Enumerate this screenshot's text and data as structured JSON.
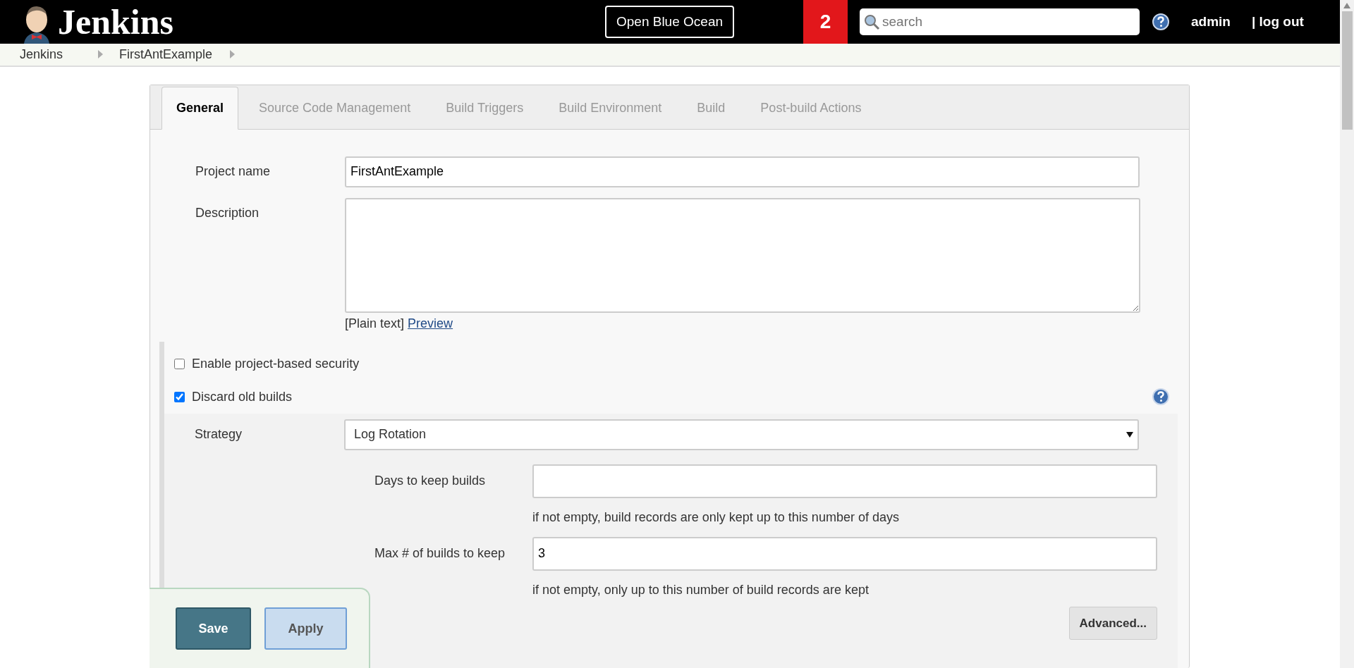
{
  "header": {
    "logo_text": "Jenkins",
    "blue_ocean_button": "Open Blue Ocean",
    "notification_count": "2",
    "search": {
      "placeholder": "search"
    },
    "user": "admin",
    "logout": "| log out"
  },
  "breadcrumbs": [
    "Jenkins",
    "FirstAntExample"
  ],
  "tabs": [
    {
      "label": "General",
      "selected": true
    },
    {
      "label": "Source Code Management",
      "selected": false
    },
    {
      "label": "Build Triggers",
      "selected": false
    },
    {
      "label": "Build Environment",
      "selected": false
    },
    {
      "label": "Build",
      "selected": false
    },
    {
      "label": "Post-build Actions",
      "selected": false
    }
  ],
  "project_name": {
    "label": "Project name",
    "value": "FirstAntExample"
  },
  "description": {
    "label": "Description",
    "format": "[Plain text]",
    "preview_link": "Preview"
  },
  "options": [
    {
      "label": "Enable project-based security",
      "checked": false
    },
    {
      "label": "Discard old builds",
      "checked": true
    }
  ],
  "strategy": {
    "label": "Strategy",
    "value": "Log Rotation"
  },
  "rotation_fields": [
    {
      "label": "Days to keep builds",
      "hint": "if not empty, build records are only kept up to this number of days"
    },
    {
      "label": "Max # of builds to keep",
      "value": "3",
      "hint": "if not empty, only up to this number of build records are kept"
    }
  ],
  "advanced_button": "Advanced...",
  "actions": {
    "save": "Save",
    "apply": "Apply"
  }
}
